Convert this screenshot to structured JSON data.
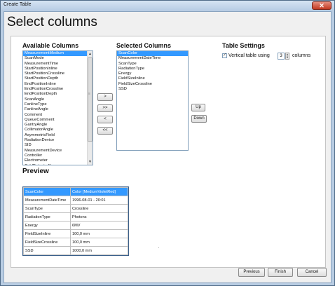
{
  "window": {
    "title": "Create Table",
    "close_glyph": "✕"
  },
  "header": {
    "title": "Select columns"
  },
  "available": {
    "label": "Available Columns",
    "items": [
      "MeasurementMedium",
      "ScanMode",
      "MeasurementTime",
      "StartPositionInline",
      "StartPositionCrossline",
      "StartPositionDepth",
      "EndPositionInline",
      "EndPositionCrossline",
      "EndPositionDepth",
      "ScanAngle",
      "FanlineType",
      "FanlineAngle",
      "Comment",
      "QueueComment",
      "GantryAngle",
      "CollimatorAngle",
      "AsymmetricField",
      "RadiationDevice",
      "SID",
      "MeasurementDevice",
      "Controller",
      "Electrometer",
      "ColdDetectorName"
    ],
    "selected_index": 0
  },
  "transfer_buttons": {
    "add": ">",
    "add_all": ">>",
    "remove": "<",
    "remove_all": "<<"
  },
  "selected": {
    "label": "Selected Columns",
    "items": [
      "ScanColor",
      "MeasurementDateTime",
      "ScanType",
      "RadiationType",
      "Energy",
      "FieldSizeInline",
      "FieldSizeCrossline",
      "SSD"
    ],
    "selected_index": 0
  },
  "order_buttons": {
    "up": "Up",
    "down": "Down"
  },
  "settings": {
    "label": "Table Settings",
    "vertical_checked": true,
    "check_glyph": "✓",
    "vertical_label": "Vertical table using",
    "columns_value": "3",
    "columns_label": "columns"
  },
  "preview": {
    "label": "Preview",
    "rows": [
      [
        "ScanColor",
        "Color [MediumVioletRed]"
      ],
      [
        "MeasurementDateTime",
        "1996-08-01 - 20:01"
      ],
      [
        "ScanType",
        "Crossline"
      ],
      [
        "RadiationType",
        "Photons"
      ],
      [
        "Energy",
        "6MV"
      ],
      [
        "FieldSizeInline",
        "100,0 mm"
      ],
      [
        "FieldSizeCrossline",
        "100,0 mm"
      ],
      [
        "SSD",
        "1000,0 mm"
      ]
    ],
    "selected_row": 0
  },
  "footer": {
    "previous": "Previous",
    "finish": "Finish",
    "cancel": "Cancel"
  },
  "colors": {
    "selection": "#3399ff",
    "window_frame": "#b9cde3"
  }
}
